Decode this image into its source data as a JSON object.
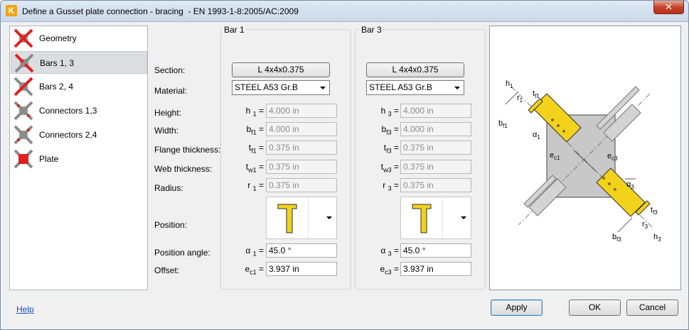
{
  "window": {
    "title": "Define a Gusset plate connection - bracing  - EN 1993-1-8:2005/AC:2009",
    "close_label": "✕",
    "app_icon_letter": "K"
  },
  "nav": {
    "items": [
      {
        "label": "Geometry",
        "icon": "cross-brace-icon"
      },
      {
        "label": "Bars 1, 3",
        "icon": "cross-brace-icon",
        "selected": true
      },
      {
        "label": "Bars 2, 4",
        "icon": "cross-brace-icon"
      },
      {
        "label": "Connectors 1,3",
        "icon": "cross-brace-icon"
      },
      {
        "label": "Connectors 2,4",
        "icon": "cross-brace-icon"
      },
      {
        "label": "Plate",
        "icon": "cross-brace-icon"
      }
    ]
  },
  "labels": {
    "section": "Section:",
    "material": "Material:",
    "height": "Height:",
    "width": "Width:",
    "flange_thickness": "Flange thickness:",
    "web_thickness": "Web thickness:",
    "radius": "Radius:",
    "position": "Position:",
    "position_angle": "Position angle:",
    "offset": "Offset:"
  },
  "bar1": {
    "title": "Bar 1",
    "section": "L 4x4x0.375",
    "material": "STEEL A53 Gr.B",
    "sym_h": "h",
    "sub_h": "1",
    "sym_b": "b",
    "sub_b": "f1",
    "sym_tf": "t",
    "sub_tf": "f1",
    "sym_tw": "t",
    "sub_tw": "w1",
    "sym_r": "r",
    "sub_r": "1",
    "sym_a": "α",
    "sub_a": "1",
    "sym_e": "e",
    "sub_e": "c1",
    "eq": "=",
    "height": "4.000 in",
    "width": "4.000 in",
    "flange_thickness": "0.375 in",
    "web_thickness": "0.375 in",
    "radius": "0.375 in",
    "position_angle": "45.0 °",
    "offset": "3.937 in"
  },
  "bar3": {
    "title": "Bar 3",
    "section": "L 4x4x0.375",
    "material": "STEEL A53 Gr.B",
    "sym_h": "h",
    "sub_h": "3",
    "sym_b": "b",
    "sub_b": "f3",
    "sym_tf": "t",
    "sub_tf": "f3",
    "sym_tw": "t",
    "sub_tw": "w3",
    "sym_r": "r",
    "sub_r": "3",
    "sym_a": "α",
    "sub_a": "3",
    "sym_e": "e",
    "sub_e": "c3",
    "eq": "=",
    "height": "4.000 in",
    "width": "4.000 in",
    "flange_thickness": "0.375 in",
    "web_thickness": "0.375 in",
    "radius": "0.375 in",
    "position_angle": "45.0 °",
    "offset": "3.937 in"
  },
  "diagram": {
    "labels": {
      "h1": "h",
      "h1s": "1",
      "r1": "r",
      "r1s": "1",
      "tf1": "t",
      "tf1s": "f1",
      "bf1": "b",
      "bf1s": "f1",
      "a1": "α",
      "a1s": "1",
      "ec1": "e",
      "ec1s": "c1",
      "ec3": "e",
      "ec3s": "c3",
      "a3": "α",
      "a3s": "3",
      "tf3": "t",
      "tf3s": "f3",
      "r3": "r",
      "r3s": "3",
      "bf3": "b",
      "bf3s": "f3",
      "h3": "h",
      "h3s": "3"
    },
    "colors": {
      "profile": "#f2d21b",
      "plate": "#c8c8c8"
    }
  },
  "footer": {
    "help": "Help",
    "apply": "Apply",
    "ok": "OK",
    "cancel": "Cancel"
  }
}
